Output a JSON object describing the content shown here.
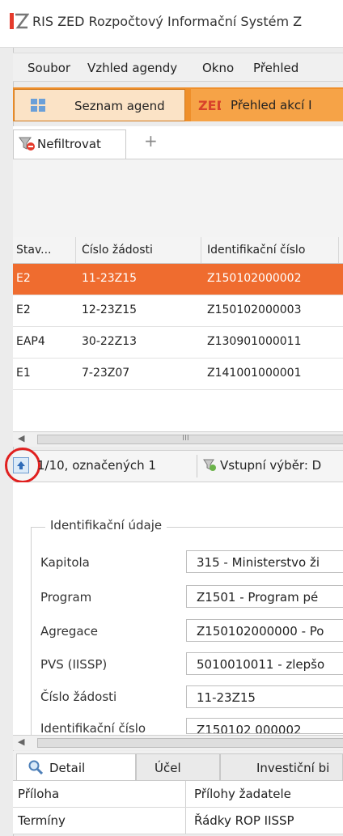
{
  "window": {
    "title": "RIS ZED Rozpočtový Informační Systém Z"
  },
  "menu": [
    "Soubor",
    "Vzhled agendy",
    "Okno",
    "Přehled"
  ],
  "tabs": [
    {
      "label": "Seznam agend",
      "icon": "grid-icon"
    },
    {
      "label": "Přehled akcí I",
      "icon": "zed-logo-icon"
    }
  ],
  "filter": {
    "tab_label": "Nefiltrovat",
    "add_label": "+"
  },
  "grid": {
    "columns": [
      "Stav...",
      "Číslo žádosti",
      "Identifikační číslo"
    ],
    "rows": [
      {
        "stav": "E2",
        "cislo": "11-23Z15",
        "id": "Z150102000002",
        "selected": true
      },
      {
        "stav": "E2",
        "cislo": "12-23Z15",
        "id": "Z150102000003",
        "selected": false
      },
      {
        "stav": "EAP4",
        "cislo": "30-22Z13",
        "id": "Z130901000011",
        "selected": false
      },
      {
        "stav": "E1",
        "cislo": "7-23Z07",
        "id": "Z141001000001",
        "selected": false
      }
    ],
    "scroll_glyph": "III"
  },
  "status": {
    "count": "1/10, označených 1",
    "selection": "Vstupní výběr: D"
  },
  "form": {
    "group_title": "Identifikační údaje",
    "fields": [
      {
        "label": "Kapitola",
        "value": "315 - Ministerstvo ži"
      },
      {
        "label": "Program",
        "value": "Z1501 - Program pé"
      },
      {
        "label": "Agregace",
        "value": "Z150102000000 - Po"
      },
      {
        "label": "PVS (IISSP)",
        "value": "5010010011 - zlepšo"
      },
      {
        "label": "Číslo žádosti",
        "value": "11-23Z15"
      },
      {
        "label": "Identifikační číslo",
        "value": "Z150102 000002"
      }
    ]
  },
  "bottom_tabs": [
    "Detail",
    "Účel",
    "Investiční bi"
  ],
  "links": [
    [
      "Příloha",
      "Přílohy žadatele"
    ],
    [
      "Termíny",
      "Řádky ROP IISSP"
    ]
  ],
  "colors": {
    "accent": "#ef8f2a",
    "selected_row": "#ef6c2f",
    "highlight_circle": "#e0201f"
  }
}
